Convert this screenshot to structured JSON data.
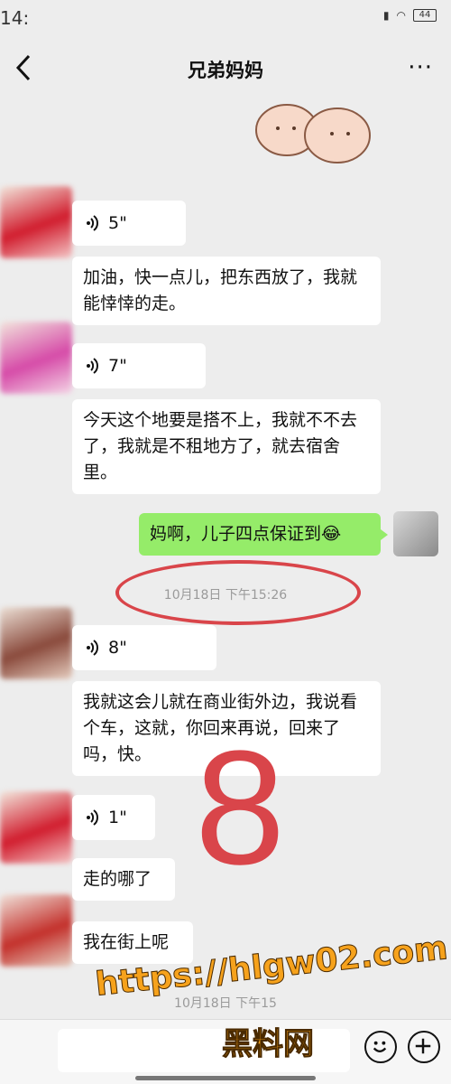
{
  "status_bar": {
    "time": "14:",
    "battery": "44"
  },
  "header": {
    "title": "兄弟妈妈"
  },
  "messages": [
    {
      "type": "voice",
      "side": "left",
      "duration": "5\""
    },
    {
      "type": "text",
      "side": "left",
      "text": "加油，快一点儿，把东西放了，我就能悻悻的走。"
    },
    {
      "type": "voice",
      "side": "left",
      "duration": "7\""
    },
    {
      "type": "text",
      "side": "left",
      "text": "今天这个地要是搭不上，我就不不去了，我就是不租地方了，就去宿舍里。"
    },
    {
      "type": "text",
      "side": "right",
      "text": "妈啊，儿子四点保证到😂"
    },
    {
      "type": "voice",
      "side": "left",
      "duration": "8\""
    },
    {
      "type": "text",
      "side": "left",
      "text": "我就这会儿就在商业街外边，我说看个车，这就，你回来再说，回来了吗，快。"
    },
    {
      "type": "voice",
      "side": "left",
      "duration": "1\""
    },
    {
      "type": "text",
      "side": "left",
      "text": "走的哪了"
    },
    {
      "type": "text",
      "side": "left",
      "text": "我在街上呢"
    }
  ],
  "timestamps": [
    "10月18日 下午15:26",
    "10月18日 下午15"
  ],
  "annotation": {
    "number": "8",
    "color": "#d9454a"
  },
  "watermark": {
    "url": "https://hlgw02.com",
    "name": "黑料网"
  },
  "colors": {
    "background": "#ededed",
    "my_bubble": "#95ec69",
    "their_bubble": "#ffffff"
  }
}
